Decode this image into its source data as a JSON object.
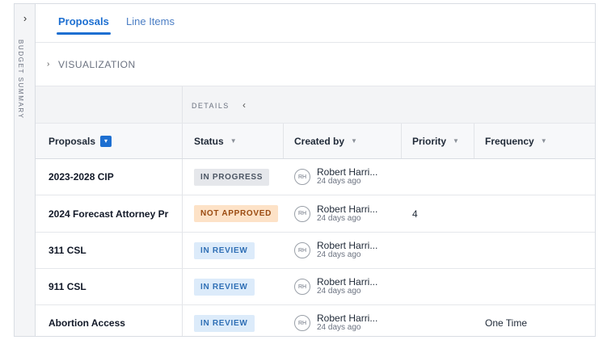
{
  "sidebar": {
    "label": "BUDGET SUMMARY",
    "toggle_icon": "chevron-right-icon"
  },
  "tabs": [
    {
      "label": "Proposals",
      "active": true
    },
    {
      "label": "Line Items",
      "active": false
    }
  ],
  "visualization": {
    "label": "VISUALIZATION"
  },
  "details": {
    "label": "DETAILS"
  },
  "colors": {
    "accent": "#1d6fd1",
    "in_progress": "#e5e7eb",
    "not_approved": "#fde2c7",
    "in_review": "#dcebfa"
  },
  "table": {
    "headers": {
      "proposals": "Proposals",
      "status": "Status",
      "created_by": "Created by",
      "priority": "Priority",
      "frequency": "Frequency"
    },
    "rows": [
      {
        "name": "2023-2028 CIP",
        "status": "IN PROGRESS",
        "initials": "RH",
        "creator": "Robert Harri...",
        "time": "24 days ago",
        "priority": "",
        "frequency": ""
      },
      {
        "name": "2024 Forecast Attorney Pr",
        "status": "NOT APPROVED",
        "initials": "RH",
        "creator": "Robert Harri...",
        "time": "24 days ago",
        "priority": "4",
        "frequency": ""
      },
      {
        "name": "311 CSL",
        "status": "IN REVIEW",
        "initials": "RH",
        "creator": "Robert Harri...",
        "time": "24 days ago",
        "priority": "",
        "frequency": ""
      },
      {
        "name": "911 CSL",
        "status": "IN REVIEW",
        "initials": "RH",
        "creator": "Robert Harri...",
        "time": "24 days ago",
        "priority": "",
        "frequency": ""
      },
      {
        "name": "Abortion Access",
        "status": "IN REVIEW",
        "initials": "RH",
        "creator": "Robert Harri...",
        "time": "24 days ago",
        "priority": "",
        "frequency": "One Time"
      }
    ]
  }
}
